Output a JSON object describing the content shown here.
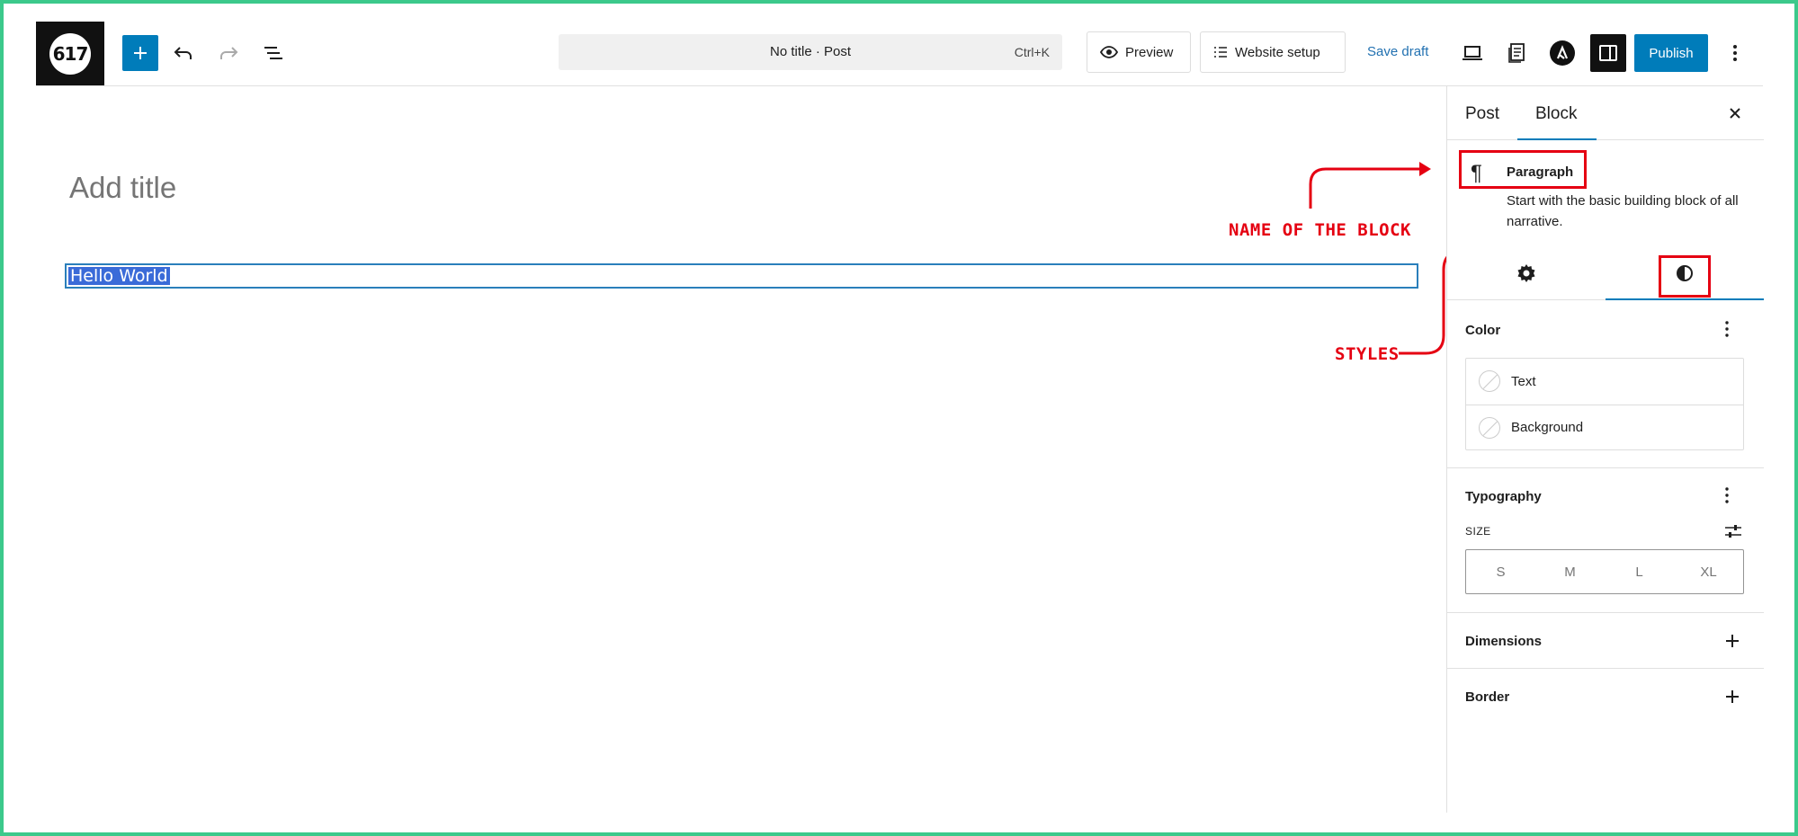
{
  "header": {
    "logo_text": "617",
    "command_bar": {
      "title": "No title · Post",
      "shortcut": "Ctrl+K"
    },
    "preview_label": "Preview",
    "website_setup_label": "Website setup",
    "save_draft_label": "Save draft",
    "publish_label": "Publish"
  },
  "editor": {
    "title_placeholder": "Add title",
    "paragraph_text": "Hello World"
  },
  "sidebar": {
    "tabs": [
      "Post",
      "Block"
    ],
    "active_tab": "Block",
    "block": {
      "name": "Paragraph",
      "description": "Start with the basic building block of all narrative."
    },
    "color": {
      "title": "Color",
      "items": [
        "Text",
        "Background"
      ]
    },
    "typography": {
      "title": "Typography",
      "size_label": "SIZE",
      "size_options": [
        "S",
        "M",
        "L",
        "XL"
      ]
    },
    "dimensions_title": "Dimensions",
    "border_title": "Border"
  },
  "annotations": {
    "block_name_label": "NAME OF THE BLOCK",
    "styles_label": "STYLES",
    "color": "#e50012"
  },
  "colors": {
    "accent": "#007cba",
    "frame": "#3cc98b",
    "selection": "#3a6bd8"
  }
}
